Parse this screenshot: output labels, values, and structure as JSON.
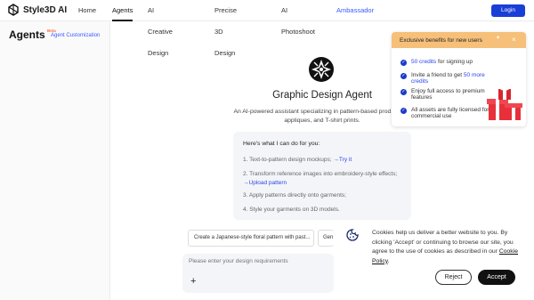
{
  "app": {
    "logo_text": "Style3D AI"
  },
  "nav": {
    "items": [
      {
        "label": "Home"
      },
      {
        "label": "Agents"
      },
      {
        "label": "AI Creative Design"
      },
      {
        "label": "Precise 3D Design"
      },
      {
        "label": "AI Photoshoot"
      },
      {
        "label": "Ambassador"
      }
    ],
    "login_label": "Login"
  },
  "sidebar": {
    "title": "Agents",
    "beta_badge": "Beta",
    "customization_link": "Agent Customization"
  },
  "agent": {
    "title": "Graphic Design Agent",
    "description": "An AI-powered assistant specializing in pattern-based prod... hats, appliques, and T-shirt prints.",
    "capabilities_heading": "Here's what I can do for you:",
    "capabilities": [
      {
        "text": "1. Text-to-pattern design mockups;",
        "link": "→Try it"
      },
      {
        "text": "2. Transform reference images into embroidery-style effects;",
        "link": "→Upload pattern"
      },
      {
        "text": "3. Apply patterns directly onto garments;",
        "link": ""
      },
      {
        "text": "4. Style your garments on 3D models.",
        "link": ""
      }
    ]
  },
  "suggestions": [
    "Create a Japanese-style floral pattern with past...",
    "Gen"
  ],
  "input": {
    "placeholder": "Please enter your design requirements"
  },
  "promo": {
    "title": "Exclusive benefits for new users",
    "benefits": [
      {
        "highlight": "50 credits",
        "text": " for signing up"
      },
      {
        "text": "Invite a friend to get ",
        "highlight": "50 more credits"
      },
      {
        "text": "Enjoy full access to premium features"
      },
      {
        "text": "All assets are fully licensed for commercial use"
      }
    ]
  },
  "cookie": {
    "text": "Cookies help us deliver a better website to you. By clicking 'Accept' or continuing to browse our site, you agree to the use of cookies as described in our",
    "policy_link": "Cookie Policy",
    "period": ".",
    "reject_label": "Reject",
    "accept_label": "Accept"
  },
  "colors": {
    "accent": "#1a3fd6",
    "promo_header": "#f6c07a",
    "link": "#2b46e8"
  }
}
